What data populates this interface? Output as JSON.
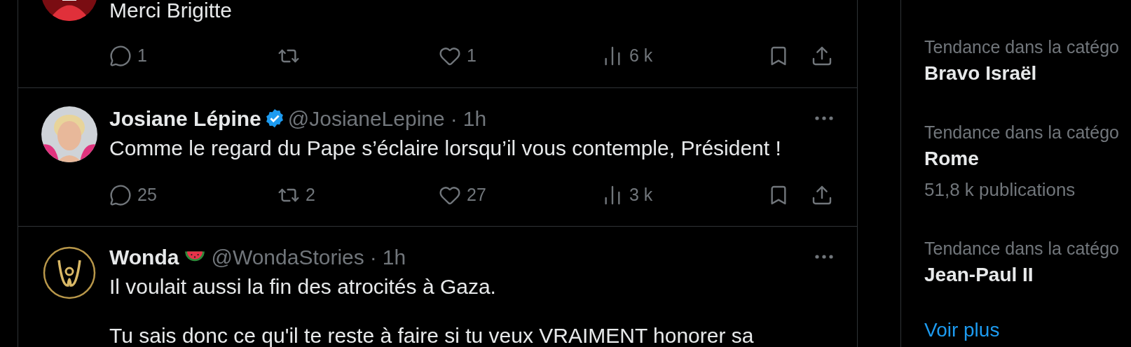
{
  "tweets": [
    {
      "text": [
        "Merci Brigitte"
      ],
      "actions": [
        {
          "kind": "reply",
          "count": "1"
        },
        {
          "kind": "repost"
        },
        {
          "kind": "like",
          "count": "1"
        },
        {
          "kind": "views",
          "count": "6 k"
        },
        {
          "kind": "bookmark"
        },
        {
          "kind": "share"
        }
      ]
    },
    {
      "author": "Josiane Lépine",
      "badge": {
        "kind": "verified"
      },
      "handle": "@JosianeLepine",
      "separator": "·",
      "time": "1h",
      "text": [
        "Comme le regard du Pape s’éclaire lorsqu’il vous contemple, Président !"
      ],
      "actions": [
        {
          "kind": "reply",
          "count": "25"
        },
        {
          "kind": "repost",
          "count": "2"
        },
        {
          "kind": "like",
          "count": "27"
        },
        {
          "kind": "views",
          "count": "3 k"
        },
        {
          "kind": "bookmark"
        },
        {
          "kind": "share"
        }
      ]
    },
    {
      "author": "Wonda",
      "badge": {
        "kind": "watermelon"
      },
      "handle": "@WondaStories",
      "separator": "·",
      "time": "1h",
      "text": [
        "Il voulait aussi la fin des atrocités à Gaza.",
        "Tu sais donc ce qu'il te reste à faire si tu veux VRAIMENT honorer sa"
      ]
    }
  ],
  "trends": [
    {
      "category": "Tendance dans la catégo",
      "name": "Bravo Israël"
    },
    {
      "category": "Tendance dans la catégo",
      "name": "Rome",
      "posts": "51,8 k publications"
    },
    {
      "category": "Tendance dans la catégo",
      "name": "Jean-Paul II"
    }
  ],
  "show_more": "Voir plus"
}
